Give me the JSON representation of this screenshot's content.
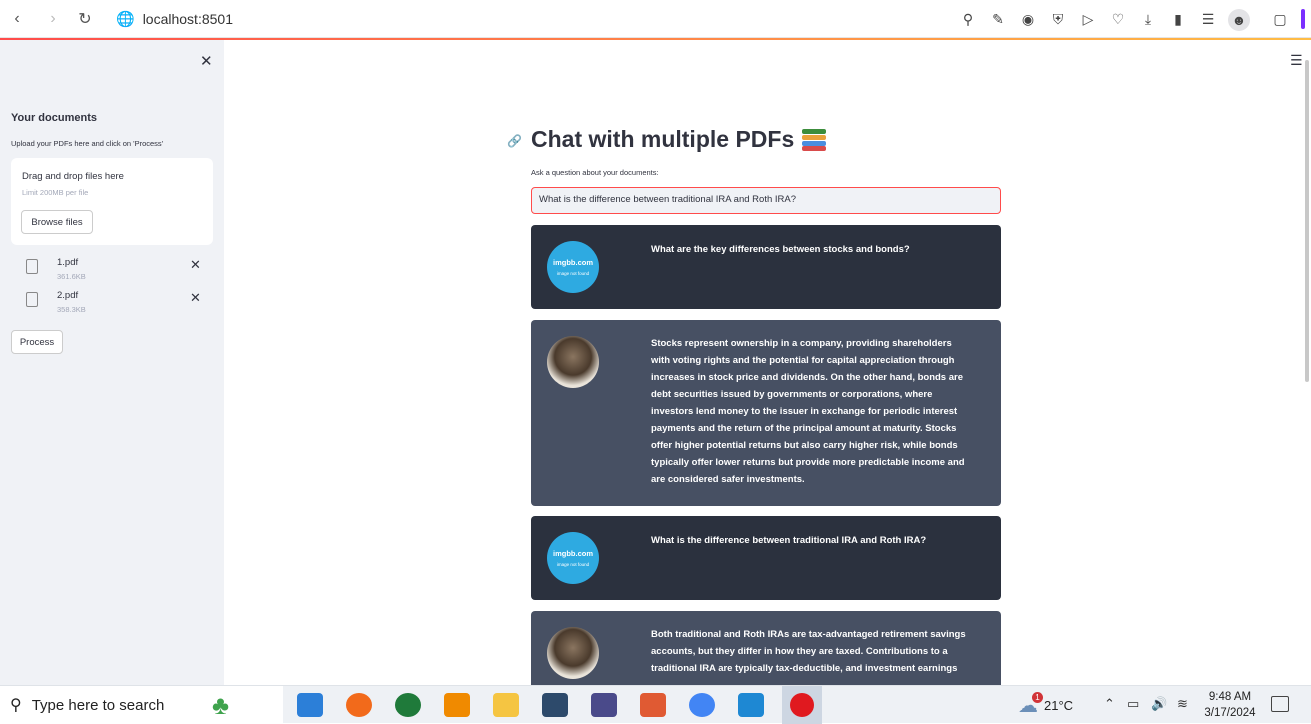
{
  "browser": {
    "url": "localhost:8501"
  },
  "sidebar": {
    "title": "Your documents",
    "subtitle": "Upload your PDFs here and click on 'Process'",
    "dropzone_title": "Drag and drop files here",
    "dropzone_limit": "Limit 200MB per file",
    "browse_label": "Browse files",
    "files": [
      {
        "name": "1.pdf",
        "size": "361.6KB"
      },
      {
        "name": "2.pdf",
        "size": "358.3KB"
      }
    ],
    "process_label": "Process"
  },
  "main": {
    "title": "Chat with multiple PDFs",
    "question_label": "Ask a question about your documents:",
    "question_value": "What is the difference between traditional IRA and Roth IRA?",
    "messages": [
      {
        "role": "user",
        "avatar_text": "imgbb.com",
        "avatar_sub": "image not found",
        "text": "What are the key differences between stocks and bonds?"
      },
      {
        "role": "bot",
        "text": "Stocks represent ownership in a company, providing shareholders with voting rights and the potential for capital appreciation through increases in stock price and dividends. On the other hand, bonds are debt securities issued by governments or corporations, where investors lend money to the issuer in exchange for periodic interest payments and the return of the principal amount at maturity. Stocks offer higher potential returns but also carry higher risk, while bonds typically offer lower returns but provide more predictable income and are considered safer investments."
      },
      {
        "role": "user",
        "avatar_text": "imgbb.com",
        "avatar_sub": "image not found",
        "text": "What is the difference between traditional IRA and Roth IRA?"
      },
      {
        "role": "bot",
        "text": "Both traditional and Roth IRAs are tax-advantaged retirement savings accounts, but they differ in how they are taxed. Contributions to a traditional IRA are typically tax-deductible, and investment earnings"
      }
    ]
  },
  "taskbar": {
    "search_placeholder": "Type here to search",
    "temperature": "21°C",
    "weather_badge": "1",
    "time": "9:48 AM",
    "date": "3/17/2024"
  },
  "colors": {
    "user_bubble": "#2b313e",
    "bot_bubble": "#475063",
    "accent": "#ff4b4b"
  }
}
